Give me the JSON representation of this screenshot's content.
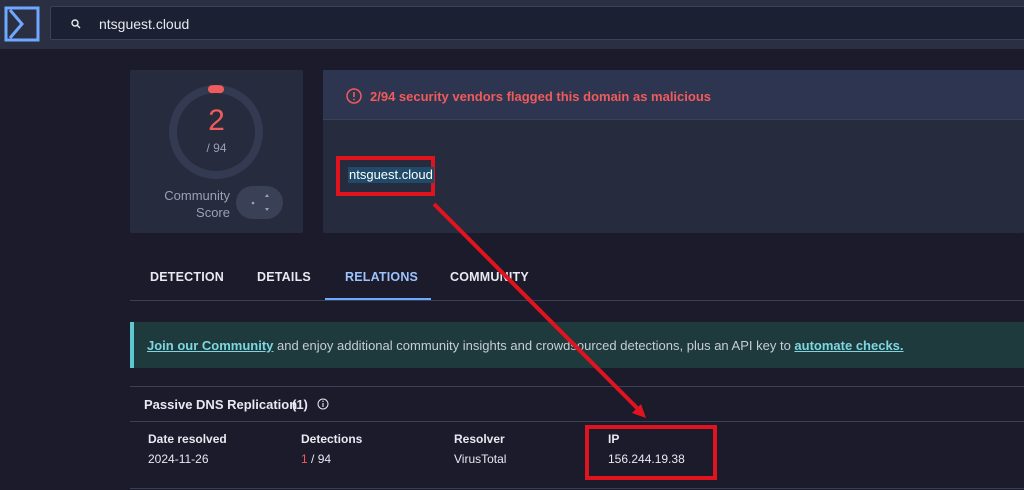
{
  "search": {
    "query": "ntsguest.cloud"
  },
  "score": {
    "detected": "2",
    "total": "/ 94",
    "community_label_1": "Community",
    "community_label_2": "Score",
    "fraction": 0.0213
  },
  "alert": {
    "text": "2/94 security vendors flagged this domain as malicious"
  },
  "domain": {
    "name": "ntsguest.cloud"
  },
  "tabs": [
    {
      "label": "DETECTION"
    },
    {
      "label": "DETAILS"
    },
    {
      "label": "RELATIONS"
    },
    {
      "label": "COMMUNITY"
    }
  ],
  "banner": {
    "link1": "Join our Community",
    "middle": " and enjoy additional community insights and crowdsourced detections, plus an API key to ",
    "link2": "automate checks."
  },
  "passive_dns": {
    "title": "Passive DNS Replication",
    "count": "(1)",
    "headers": [
      "Date resolved",
      "Detections",
      "Resolver",
      "IP"
    ],
    "row": {
      "date": "2024-11-26",
      "det_hits": "1",
      "det_total": " / 94",
      "resolver": "VirusTotal",
      "ip": "156.244.19.38"
    }
  },
  "colors": {
    "accent": "#6ea8ff",
    "danger": "#f05b5b",
    "annotation": "#e0141e"
  }
}
